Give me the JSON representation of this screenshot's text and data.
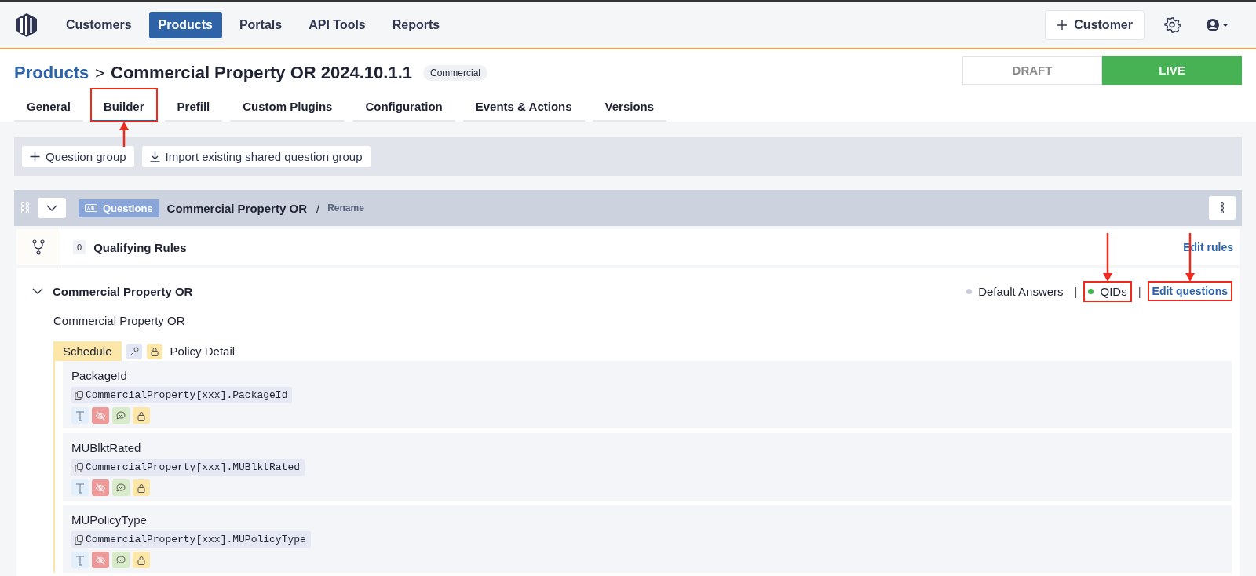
{
  "nav": {
    "items": [
      {
        "label": "Customers",
        "selected": false
      },
      {
        "label": "Products",
        "selected": true
      },
      {
        "label": "Portals",
        "selected": false
      },
      {
        "label": "API Tools",
        "selected": false
      },
      {
        "label": "Reports",
        "selected": false
      }
    ],
    "add_button": "Customer"
  },
  "header": {
    "breadcrumb": "Products",
    "arrow": ">",
    "title": "Commercial Property OR 2024.10.1.1",
    "tag": "Commercial",
    "modes": [
      {
        "label": "DRAFT",
        "selected": false
      },
      {
        "label": "LIVE",
        "selected": true
      }
    ]
  },
  "tabs": [
    {
      "label": "General",
      "selected": false,
      "annotated": false
    },
    {
      "label": "Builder",
      "selected": true,
      "annotated": true
    },
    {
      "label": "Prefill",
      "selected": false,
      "annotated": false
    },
    {
      "label": "Custom Plugins",
      "selected": false,
      "annotated": false
    },
    {
      "label": "Configuration",
      "selected": false,
      "annotated": false
    },
    {
      "label": "Events & Actions",
      "selected": false,
      "annotated": false
    },
    {
      "label": "Versions",
      "selected": false,
      "annotated": false
    }
  ],
  "toolbar": {
    "buttons": [
      {
        "label": "Question group"
      },
      {
        "label": "Import existing shared question group"
      }
    ]
  },
  "group": {
    "badge": "Questions",
    "name": "Commercial Property OR",
    "separator": "/",
    "rename": "Rename",
    "rules": {
      "count": "0",
      "label": "Qualifying Rules",
      "edit": "Edit rules"
    },
    "section": {
      "title": "Commercial Property OR",
      "expanded": true,
      "description": "Commercial Property OR",
      "statuses": [
        {
          "label": "Default Answers",
          "color": "#c9ccd8",
          "annotated": false
        },
        {
          "label": "QIDs",
          "color": "#3cb54a",
          "annotated": true
        }
      ],
      "divider": "|",
      "edit": {
        "label": "Edit questions",
        "annotated": true
      },
      "schedule": {
        "tag": "Schedule",
        "name": "Policy Detail"
      },
      "questions": [
        {
          "name": "PackageId",
          "path": "CommercialProperty[xxx].PackageId"
        },
        {
          "name": "MUBlktRated",
          "path": "CommercialProperty[xxx].MUBlktRated"
        },
        {
          "name": "MUPolicyType",
          "path": "CommercialProperty[xxx].MUPolicyType"
        }
      ]
    }
  }
}
